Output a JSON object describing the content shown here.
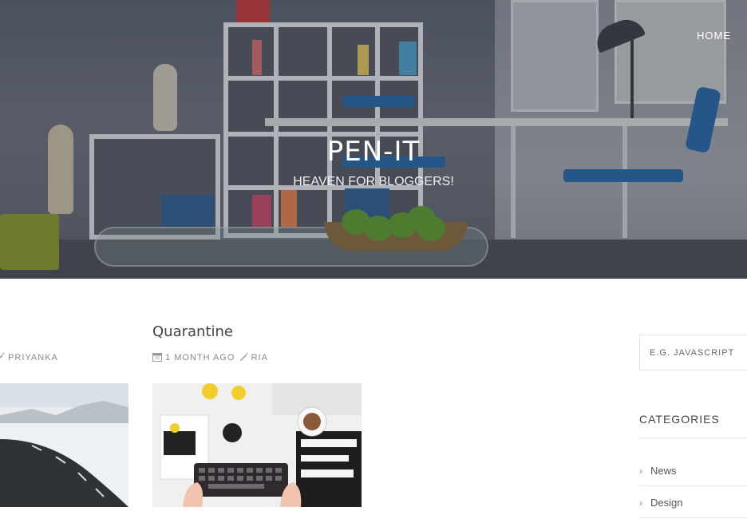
{
  "header": {
    "nav_home": "HOME",
    "site_title": "PEN-IT",
    "tagline": "HEAVEN FOR BLOGGERS!"
  },
  "posts": [
    {
      "title": "",
      "meta_author": "PRIYANKA",
      "thumbnail": "snowy-road"
    },
    {
      "title": "Quarantine",
      "meta_date": "1 MONTH AGO",
      "meta_author": "RIA",
      "thumbnail": "desk-flatlay"
    }
  ],
  "sidebar": {
    "search_placeholder": "E.G. JAVASCRIPT",
    "categories_heading": "CATEGORIES",
    "categories": [
      "News",
      "Design"
    ]
  },
  "colors": {
    "accent_blue": "#2467a8",
    "text": "#555555",
    "meta": "#888888"
  }
}
